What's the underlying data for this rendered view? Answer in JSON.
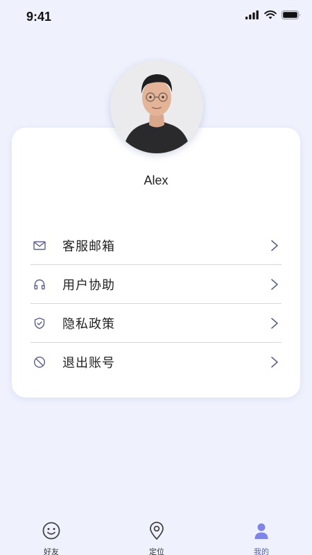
{
  "status_bar": {
    "time": "9:41"
  },
  "profile": {
    "name": "Alex"
  },
  "menu": [
    {
      "label": "客服邮箱",
      "icon": "mail-icon"
    },
    {
      "label": "用户协助",
      "icon": "headphones-icon"
    },
    {
      "label": "隐私政策",
      "icon": "shield-check-icon"
    },
    {
      "label": "退出账号",
      "icon": "ban-icon"
    }
  ],
  "tabbar": [
    {
      "label": "好友",
      "icon": "smile-icon",
      "active": false
    },
    {
      "label": "定位",
      "icon": "location-pin-icon",
      "active": false
    },
    {
      "label": "我的",
      "icon": "user-icon",
      "active": true
    }
  ],
  "colors": {
    "background": "#eff2fd",
    "card": "#ffffff",
    "accent": "#5b5fa8",
    "active_tab_icon": "#7f85e6",
    "divider": "#d6d6d6"
  }
}
